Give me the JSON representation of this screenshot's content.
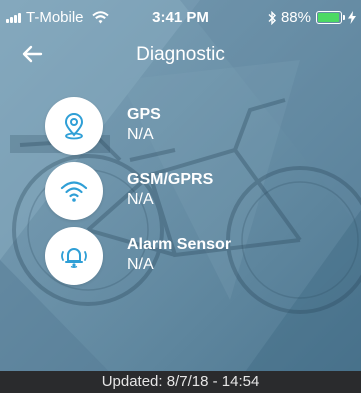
{
  "status_bar": {
    "carrier": "T-Mobile",
    "time": "3:41 PM",
    "battery_percent": "88%",
    "battery_level": 0.88,
    "battery_color": "#4cd964"
  },
  "nav": {
    "title": "Diagnostic",
    "back_icon": "arrow-left-icon"
  },
  "items": [
    {
      "label": "GPS",
      "value": "N/A",
      "icon": "location-pin-icon"
    },
    {
      "label": "GSM/GPRS",
      "value": "N/A",
      "icon": "wifi-signal-icon"
    },
    {
      "label": "Alarm Sensor",
      "value": "N/A",
      "icon": "bell-icon"
    }
  ],
  "footer": {
    "updated": "Updated: 8/7/18 - 14:54"
  },
  "colors": {
    "icon_blue": "#2f9fd6",
    "footer_bg": "#2a2b2d"
  }
}
